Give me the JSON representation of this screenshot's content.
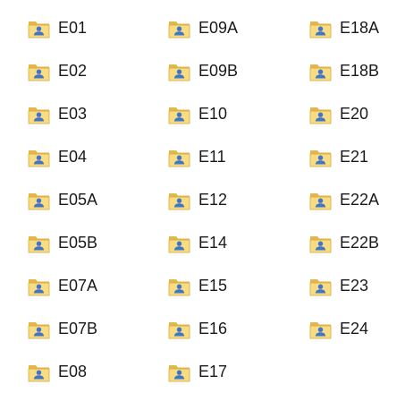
{
  "colors": {
    "folder_back": "#e2b74f",
    "folder_front": "#f8dc84",
    "folder_edge": "#d9a832",
    "user_glyph": "#3f76c8",
    "label_text": "#1a1a1a"
  },
  "icon": "user-folder-icon",
  "columns": [
    {
      "items": [
        {
          "label": "E01"
        },
        {
          "label": "E02"
        },
        {
          "label": "E03"
        },
        {
          "label": "E04"
        },
        {
          "label": "E05A"
        },
        {
          "label": "E05B"
        },
        {
          "label": "E07A"
        },
        {
          "label": "E07B"
        },
        {
          "label": "E08"
        }
      ]
    },
    {
      "items": [
        {
          "label": "E09A"
        },
        {
          "label": "E09B"
        },
        {
          "label": "E10"
        },
        {
          "label": "E11"
        },
        {
          "label": "E12"
        },
        {
          "label": "E14"
        },
        {
          "label": "E15"
        },
        {
          "label": "E16"
        },
        {
          "label": "E17"
        }
      ]
    },
    {
      "items": [
        {
          "label": "E18A"
        },
        {
          "label": "E18B"
        },
        {
          "label": "E20"
        },
        {
          "label": "E21"
        },
        {
          "label": "E22A"
        },
        {
          "label": "E22B"
        },
        {
          "label": "E23"
        },
        {
          "label": "E24"
        }
      ]
    }
  ]
}
